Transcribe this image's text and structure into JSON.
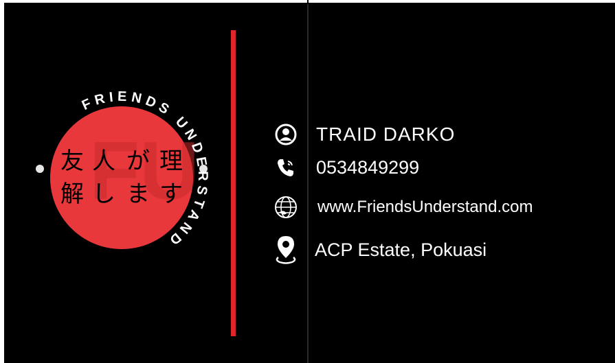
{
  "logo": {
    "ring_text": "FRIENDS UNDERSTAND",
    "kanji": [
      "友",
      "人",
      "が",
      "理",
      "解",
      "し",
      "ま",
      "す"
    ],
    "colors": {
      "circle": "#e8383b",
      "ring_text": "#ffffff",
      "kanji": "#000000"
    }
  },
  "contact": {
    "name": "TRAID DARKO",
    "phone": "0534849299",
    "website": "www.FriendsUnderstand.com",
    "address": "ACP Estate, Pokuasi"
  },
  "colors": {
    "background": "#000000",
    "accent": "#e1262b",
    "text": "#ffffff"
  },
  "icons": [
    "person-icon",
    "phone-icon",
    "globe-icon",
    "location-pin-icon"
  ]
}
